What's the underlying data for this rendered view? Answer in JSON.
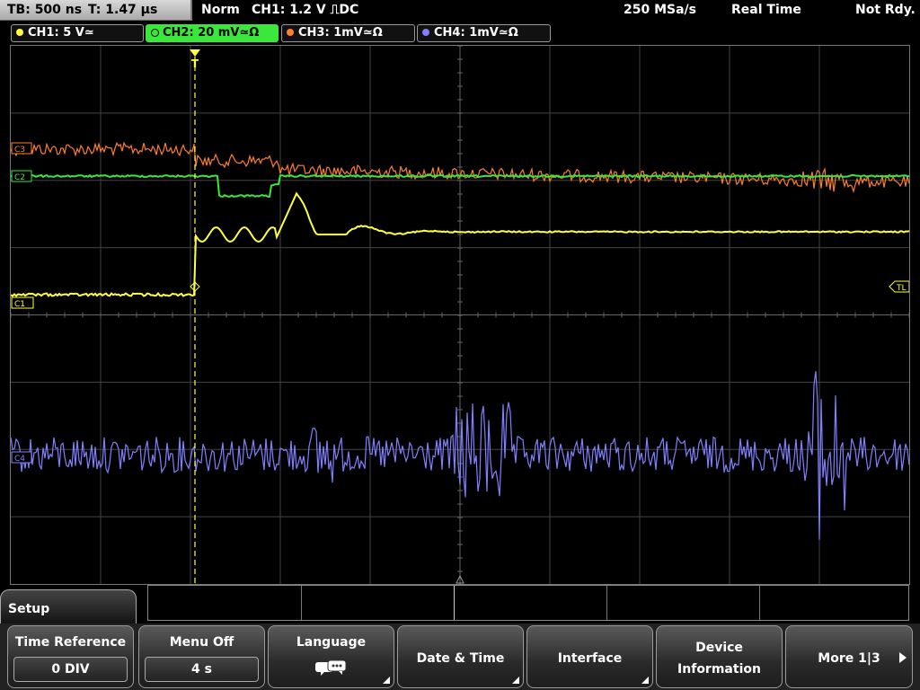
{
  "status": {
    "timebase": "TB: 500 ns",
    "trigger_time": "T: 1.47 µs",
    "mode": "Norm",
    "trigger": "CH1: 1.2 V ⎍DC",
    "sample_rate": "250 MSa/s",
    "acq_mode": "Real Time",
    "state": "Not Rdy."
  },
  "channels": [
    {
      "label": "CH1: 5 V≃",
      "color": "#ffff40"
    },
    {
      "label": "CH2: 20 mV≃Ω",
      "color": "#39e83a"
    },
    {
      "label": "CH3: 1mV≃Ω",
      "color": "#ff7f2a"
    },
    {
      "label": "CH4: 1mV≃Ω",
      "color": "#8080ff"
    }
  ],
  "markers": {
    "trigger_level": "TL",
    "ch1_ref": "C1",
    "ch2_ref": "C2",
    "ch3_ref": "C3",
    "ch4_ref": "C4",
    "trigger_pos": "T"
  },
  "menu": {
    "tab_title": "Setup",
    "keys": [
      {
        "title": "Time Reference",
        "value": "0 DIV"
      },
      {
        "title": "Menu Off",
        "value": "4 s"
      },
      {
        "title": "Language",
        "value": ""
      },
      {
        "title": "Date & Time",
        "value": ""
      },
      {
        "title": "Interface",
        "value": ""
      },
      {
        "title": "Device",
        "title2": "Information",
        "value": ""
      },
      {
        "title": "More 1|3",
        "value": ""
      }
    ]
  }
}
